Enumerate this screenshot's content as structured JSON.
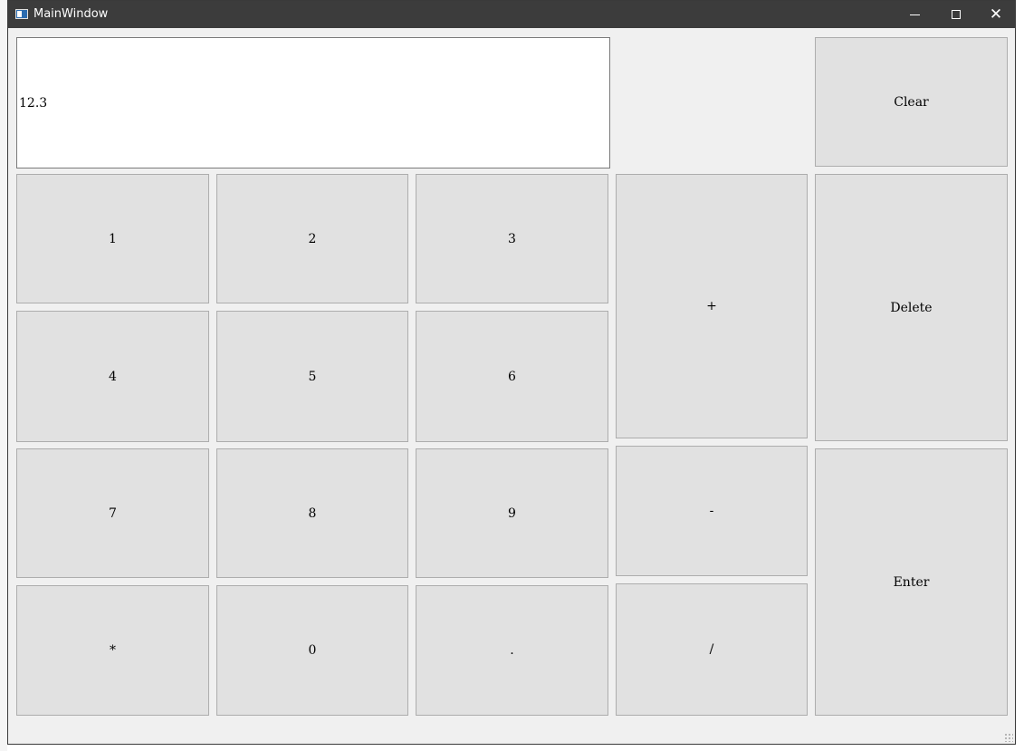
{
  "window": {
    "title": "MainWindow",
    "minimize_icon": "minimize-icon",
    "maximize_icon": "maximize-icon",
    "close_icon": "close-icon",
    "close_glyph": "✕"
  },
  "display": {
    "value": "12.3"
  },
  "keys": {
    "clear": "Clear",
    "delete": "Delete",
    "enter": "Enter",
    "plus": "+",
    "minus": "-",
    "divide": "/",
    "multiply": "*",
    "dot": ".",
    "d0": "0",
    "d1": "1",
    "d2": "2",
    "d3": "3",
    "d4": "4",
    "d5": "5",
    "d6": "6",
    "d7": "7",
    "d8": "8",
    "d9": "9"
  },
  "colors": {
    "titlebar": "#3c3c3c",
    "window_bg": "#f0f0f0",
    "key_bg": "#e1e1e1",
    "key_border": "#adadad"
  }
}
